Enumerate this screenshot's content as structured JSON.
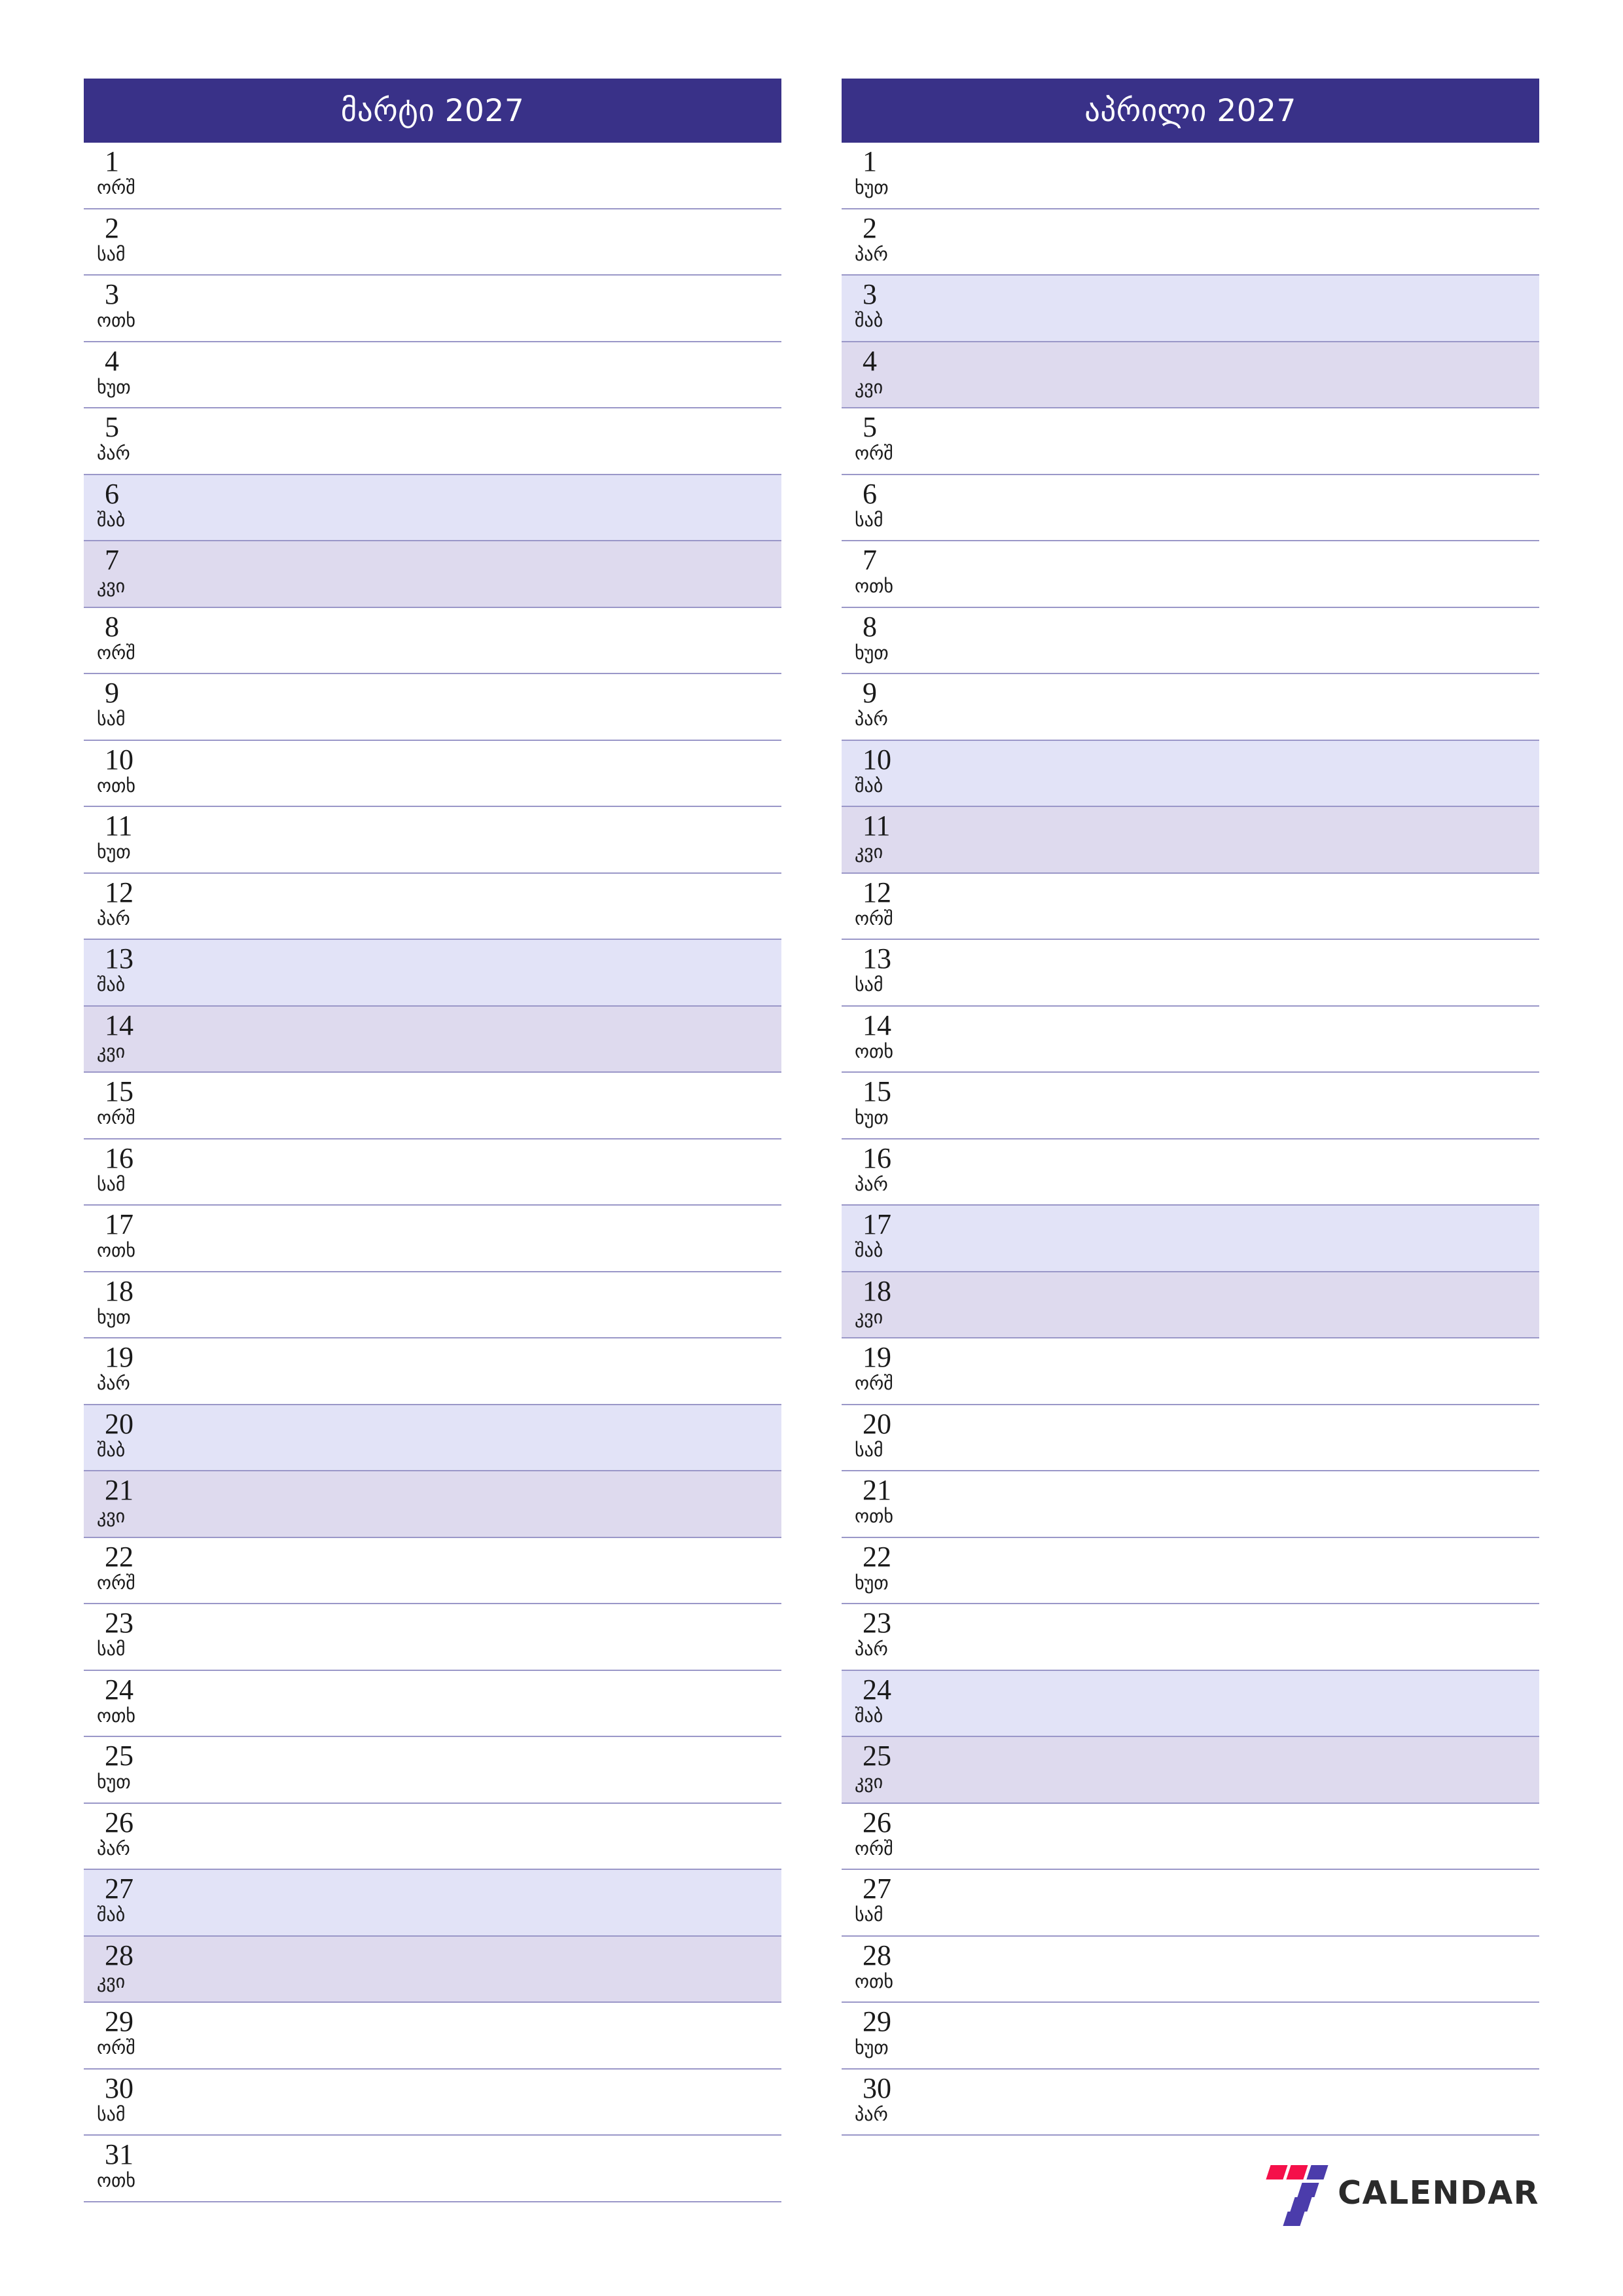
{
  "page": {
    "background_color": "#ffffff",
    "accent_color": "#393188",
    "separator_color": "#9a97c8",
    "saturday_color": "#e2e3f7",
    "sunday_color": "#dedaee"
  },
  "logo": {
    "wordmark": "CALENDAR",
    "mark_name": "seven-logo-mark",
    "red_color": "#f5104a",
    "purple_color": "#4b3cab",
    "text_color": "#2b2b2b"
  },
  "months": [
    {
      "title": "მარტი 2027",
      "name": "march",
      "days": [
        {
          "num": "1",
          "wd": "ორშ",
          "kind": "weekday"
        },
        {
          "num": "2",
          "wd": "სამ",
          "kind": "weekday"
        },
        {
          "num": "3",
          "wd": "ოთხ",
          "kind": "weekday"
        },
        {
          "num": "4",
          "wd": "ხუთ",
          "kind": "weekday"
        },
        {
          "num": "5",
          "wd": "პარ",
          "kind": "weekday"
        },
        {
          "num": "6",
          "wd": "შაბ",
          "kind": "sat"
        },
        {
          "num": "7",
          "wd": "კვი",
          "kind": "sun"
        },
        {
          "num": "8",
          "wd": "ორშ",
          "kind": "weekday"
        },
        {
          "num": "9",
          "wd": "სამ",
          "kind": "weekday"
        },
        {
          "num": "10",
          "wd": "ოთხ",
          "kind": "weekday"
        },
        {
          "num": "11",
          "wd": "ხუთ",
          "kind": "weekday"
        },
        {
          "num": "12",
          "wd": "პარ",
          "kind": "weekday"
        },
        {
          "num": "13",
          "wd": "შაბ",
          "kind": "sat"
        },
        {
          "num": "14",
          "wd": "კვი",
          "kind": "sun"
        },
        {
          "num": "15",
          "wd": "ორშ",
          "kind": "weekday"
        },
        {
          "num": "16",
          "wd": "სამ",
          "kind": "weekday"
        },
        {
          "num": "17",
          "wd": "ოთხ",
          "kind": "weekday"
        },
        {
          "num": "18",
          "wd": "ხუთ",
          "kind": "weekday"
        },
        {
          "num": "19",
          "wd": "პარ",
          "kind": "weekday"
        },
        {
          "num": "20",
          "wd": "შაბ",
          "kind": "sat"
        },
        {
          "num": "21",
          "wd": "კვი",
          "kind": "sun"
        },
        {
          "num": "22",
          "wd": "ორშ",
          "kind": "weekday"
        },
        {
          "num": "23",
          "wd": "სამ",
          "kind": "weekday"
        },
        {
          "num": "24",
          "wd": "ოთხ",
          "kind": "weekday"
        },
        {
          "num": "25",
          "wd": "ხუთ",
          "kind": "weekday"
        },
        {
          "num": "26",
          "wd": "პარ",
          "kind": "weekday"
        },
        {
          "num": "27",
          "wd": "შაბ",
          "kind": "sat"
        },
        {
          "num": "28",
          "wd": "კვი",
          "kind": "sun"
        },
        {
          "num": "29",
          "wd": "ორშ",
          "kind": "weekday"
        },
        {
          "num": "30",
          "wd": "სამ",
          "kind": "weekday"
        },
        {
          "num": "31",
          "wd": "ოთხ",
          "kind": "weekday"
        }
      ]
    },
    {
      "title": "აპრილი 2027",
      "name": "april",
      "days": [
        {
          "num": "1",
          "wd": "ხუთ",
          "kind": "weekday"
        },
        {
          "num": "2",
          "wd": "პარ",
          "kind": "weekday"
        },
        {
          "num": "3",
          "wd": "შაბ",
          "kind": "sat"
        },
        {
          "num": "4",
          "wd": "კვი",
          "kind": "sun"
        },
        {
          "num": "5",
          "wd": "ორშ",
          "kind": "weekday"
        },
        {
          "num": "6",
          "wd": "სამ",
          "kind": "weekday"
        },
        {
          "num": "7",
          "wd": "ოთხ",
          "kind": "weekday"
        },
        {
          "num": "8",
          "wd": "ხუთ",
          "kind": "weekday"
        },
        {
          "num": "9",
          "wd": "პარ",
          "kind": "weekday"
        },
        {
          "num": "10",
          "wd": "შაბ",
          "kind": "sat"
        },
        {
          "num": "11",
          "wd": "კვი",
          "kind": "sun"
        },
        {
          "num": "12",
          "wd": "ორშ",
          "kind": "weekday"
        },
        {
          "num": "13",
          "wd": "სამ",
          "kind": "weekday"
        },
        {
          "num": "14",
          "wd": "ოთხ",
          "kind": "weekday"
        },
        {
          "num": "15",
          "wd": "ხუთ",
          "kind": "weekday"
        },
        {
          "num": "16",
          "wd": "პარ",
          "kind": "weekday"
        },
        {
          "num": "17",
          "wd": "შაბ",
          "kind": "sat"
        },
        {
          "num": "18",
          "wd": "კვი",
          "kind": "sun"
        },
        {
          "num": "19",
          "wd": "ორშ",
          "kind": "weekday"
        },
        {
          "num": "20",
          "wd": "სამ",
          "kind": "weekday"
        },
        {
          "num": "21",
          "wd": "ოთხ",
          "kind": "weekday"
        },
        {
          "num": "22",
          "wd": "ხუთ",
          "kind": "weekday"
        },
        {
          "num": "23",
          "wd": "პარ",
          "kind": "weekday"
        },
        {
          "num": "24",
          "wd": "შაბ",
          "kind": "sat"
        },
        {
          "num": "25",
          "wd": "კვი",
          "kind": "sun"
        },
        {
          "num": "26",
          "wd": "ორშ",
          "kind": "weekday"
        },
        {
          "num": "27",
          "wd": "სამ",
          "kind": "weekday"
        },
        {
          "num": "28",
          "wd": "ოთხ",
          "kind": "weekday"
        },
        {
          "num": "29",
          "wd": "ხუთ",
          "kind": "weekday"
        },
        {
          "num": "30",
          "wd": "პარ",
          "kind": "weekday"
        }
      ]
    }
  ]
}
